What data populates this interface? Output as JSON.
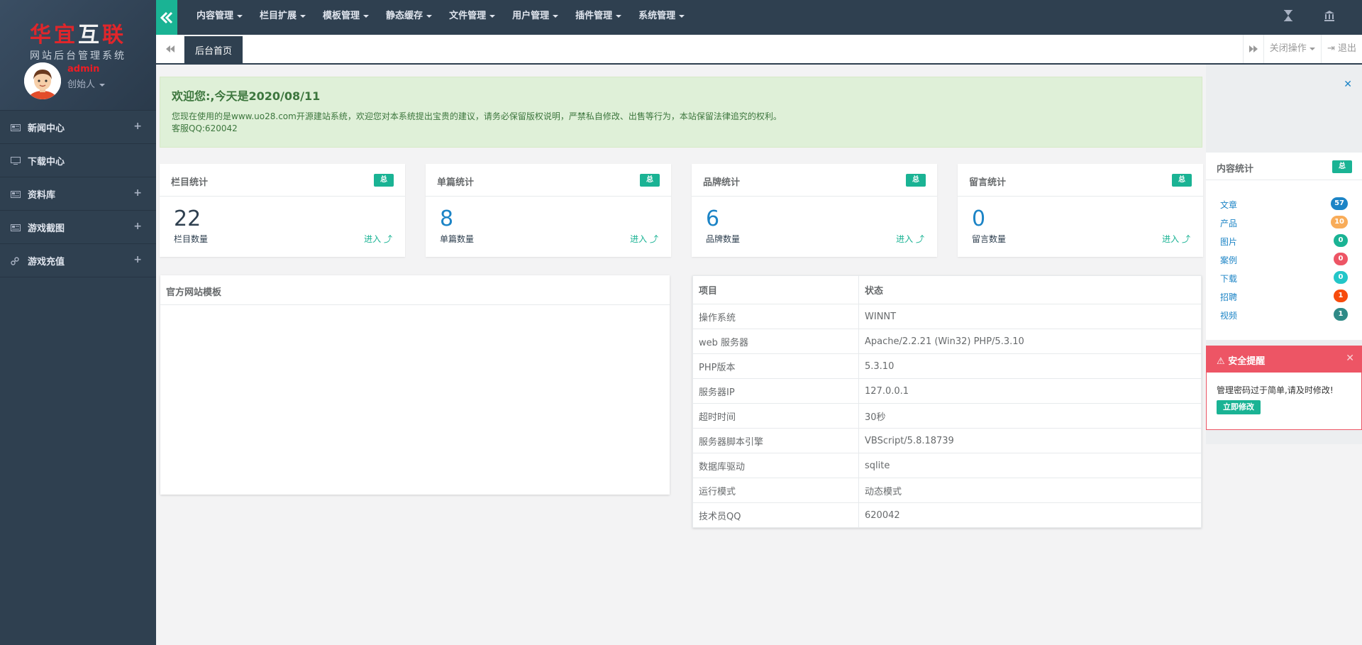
{
  "sidebar": {
    "logo_part1": "华宜",
    "logo_part2": "互",
    "logo_part3": "联",
    "subtitle": "网站后台管理系统",
    "user_name": "admin",
    "user_role": "创始人",
    "items": [
      {
        "label": "新闻中心",
        "icon": "newspaper-icon",
        "expand": "+"
      },
      {
        "label": "下载中心",
        "icon": "monitor-icon",
        "expand": ""
      },
      {
        "label": "资料库",
        "icon": "newspaper-icon",
        "expand": "+"
      },
      {
        "label": "游戏截图",
        "icon": "newspaper-icon",
        "expand": "+"
      },
      {
        "label": "游戏充值",
        "icon": "link-icon",
        "expand": "+"
      }
    ]
  },
  "topnav": {
    "menu": [
      "内容管理",
      "栏目扩展",
      "模板管理",
      "静态缓存",
      "文件管理",
      "用户管理",
      "插件管理",
      "系统管理"
    ]
  },
  "tabs": {
    "home": "后台首页",
    "close_ops": "关闭操作",
    "logout": "退出"
  },
  "welcome": {
    "title": "欢迎您:,今天是2020/08/11",
    "line1": "您现在使用的是www.uo28.com开源建站系统，欢迎您对本系统提出宝贵的建议，请务必保留版权说明，严禁私自修改、出售等行为，本站保留法律追究的权利。",
    "line2": "客服QQ:620042"
  },
  "stats": [
    {
      "title": "栏目统计",
      "badge": "总",
      "value": "22",
      "label": "栏目数量",
      "enter": "进入"
    },
    {
      "title": "单篇统计",
      "badge": "总",
      "value": "8",
      "label": "单篇数量",
      "enter": "进入"
    },
    {
      "title": "品牌统计",
      "badge": "总",
      "value": "6",
      "label": "品牌数量",
      "enter": "进入"
    },
    {
      "title": "留言统计",
      "badge": "总",
      "value": "0",
      "label": "留言数量",
      "enter": "进入"
    }
  ],
  "template_panel": {
    "title": "官方网站模板"
  },
  "sysinfo": {
    "headers": [
      "项目",
      "状态"
    ],
    "rows": [
      [
        "操作系统",
        "WINNT"
      ],
      [
        "web 服务器",
        "Apache/2.2.21 (Win32) PHP/5.3.10"
      ],
      [
        "PHP版本",
        "5.3.10"
      ],
      [
        "服务器IP",
        "127.0.0.1"
      ],
      [
        "超时时间",
        "30秒"
      ],
      [
        "服务器脚本引擎",
        "VBScript/5.8.18739"
      ],
      [
        "数据库驱动",
        "sqlite"
      ],
      [
        "运行模式",
        "动态模式"
      ],
      [
        "技术员QQ",
        "620042"
      ]
    ]
  },
  "content_stats": {
    "title": "内容统计",
    "badge": "总",
    "items": [
      {
        "label": "文章",
        "count": "57",
        "color": "#1c84c6"
      },
      {
        "label": "产品",
        "count": "10",
        "color": "#f8ac59"
      },
      {
        "label": "图片",
        "count": "0",
        "color": "#1ab394"
      },
      {
        "label": "案例",
        "count": "0",
        "color": "#ed5565"
      },
      {
        "label": "下载",
        "count": "0",
        "color": "#23c6c8"
      },
      {
        "label": "招聘",
        "count": "1",
        "color": "#f74b0c"
      },
      {
        "label": "视频",
        "count": "1",
        "color": "#2f8a87"
      }
    ]
  },
  "security": {
    "title": "安全提醒",
    "message": "管理密码过于简单,请及时修改!",
    "button": "立即修改"
  },
  "colors": {
    "sidebar_bg": "#2f4050",
    "accent_green": "#1ab394",
    "danger": "#ed5565",
    "alert_bg": "#dff0d8"
  }
}
